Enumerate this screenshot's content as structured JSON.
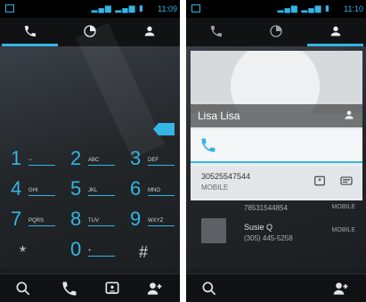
{
  "left": {
    "status": {
      "time": "11:09"
    },
    "dialer": {
      "keys": [
        {
          "digit": "1",
          "letters": ""
        },
        {
          "digit": "2",
          "letters": "ABC"
        },
        {
          "digit": "3",
          "letters": "DEF"
        },
        {
          "digit": "4",
          "letters": "GHI"
        },
        {
          "digit": "5",
          "letters": "JKL"
        },
        {
          "digit": "6",
          "letters": "MNO"
        },
        {
          "digit": "7",
          "letters": "PQRS"
        },
        {
          "digit": "8",
          "letters": "TUV"
        },
        {
          "digit": "9",
          "letters": "WXYZ"
        },
        {
          "digit": "*",
          "letters": ""
        },
        {
          "digit": "0",
          "letters": "+"
        },
        {
          "digit": "#",
          "letters": ""
        }
      ]
    }
  },
  "right": {
    "status": {
      "time": "11:10"
    },
    "contact": {
      "name": "Lisa Lisa",
      "number": "30525547544",
      "type": "MOBILE"
    },
    "list": [
      {
        "name": "",
        "number": "78531544854",
        "type": "MOBILE"
      },
      {
        "name": "Susie Q",
        "number": "(305) 445-5258",
        "type": "MOBILE"
      }
    ]
  }
}
